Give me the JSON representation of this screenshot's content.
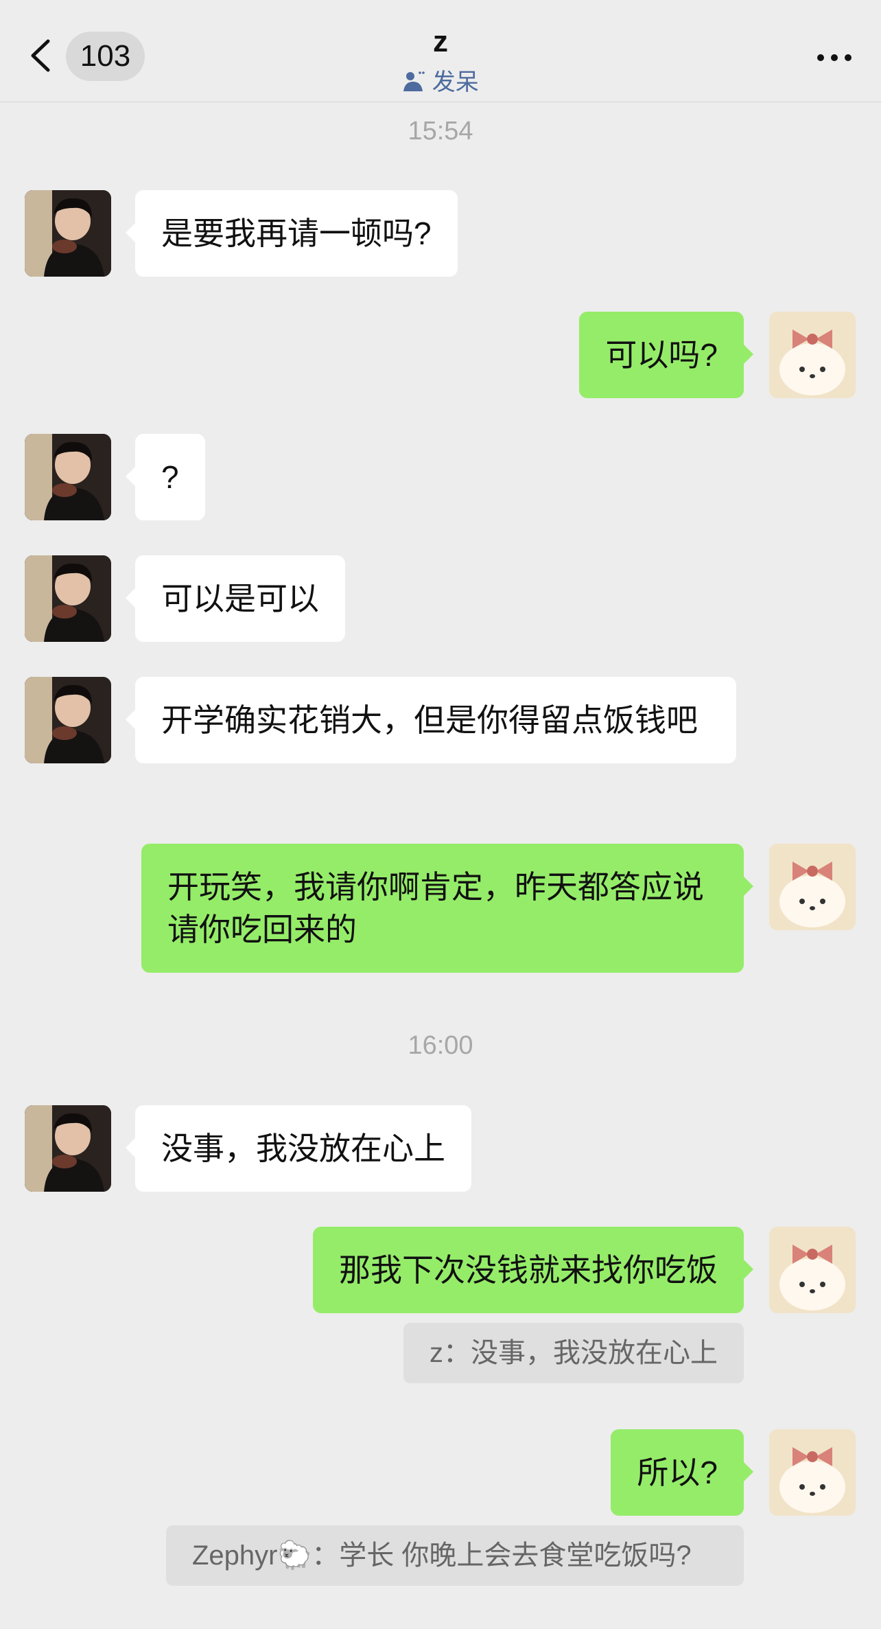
{
  "header": {
    "unread_count": "103",
    "title": "z",
    "status": "发呆"
  },
  "messages": [
    {
      "type": "time",
      "text": "15:54"
    },
    {
      "type": "in",
      "text": "是要我再请一顿吗?"
    },
    {
      "type": "out",
      "text": "可以吗?"
    },
    {
      "type": "in",
      "text": "?"
    },
    {
      "type": "in",
      "text": "可以是可以"
    },
    {
      "type": "in",
      "text": "开学确实花销大，但是你得留点饭钱吧"
    },
    {
      "type": "out",
      "text": "开玩笑，我请你啊肯定，昨天都答应说请你吃回来的"
    },
    {
      "type": "time",
      "text": "16:00"
    },
    {
      "type": "in",
      "text": "没事，我没放在心上"
    },
    {
      "type": "out",
      "text": "那我下次没钱就来找你吃饭"
    },
    {
      "type": "quote",
      "text": "z：没事，我没放在心上"
    },
    {
      "type": "out",
      "text": "所以?"
    },
    {
      "type": "quote",
      "text": "Zephyr🐑：学长 你晚上会去食堂吃饭吗?"
    }
  ],
  "colors": {
    "background": "#ededed",
    "incoming_bubble": "#ffffff",
    "outgoing_bubble": "#95ec69",
    "quote_bubble": "#dfdfdf",
    "timestamp": "#a7a7a7",
    "status_link": "#4d6b9e"
  },
  "icons": {
    "back": "chevron-left-icon",
    "more": "more-dots-icon",
    "status": "status-person-icon"
  }
}
